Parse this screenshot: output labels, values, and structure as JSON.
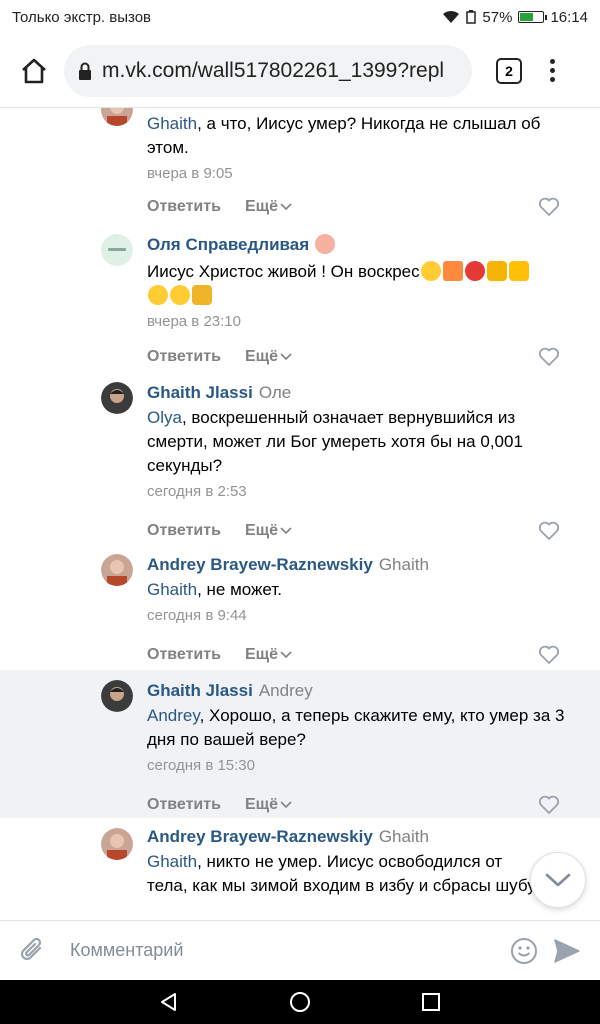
{
  "status_bar": {
    "carrier_text": "Только экстр. вызов",
    "battery_percent": "57%",
    "battery_level": 0.57,
    "time": "16:14"
  },
  "browser": {
    "url": "m.vk.com/wall517802261_1399?repl",
    "tab_count": "2"
  },
  "comments": [
    {
      "author": "",
      "reply_to": "",
      "mention": "Ghaith",
      "text": ", а что, Иисус умер? Никогда не слышал об этом.",
      "time": "вчера в 9:05",
      "reply_label": "Ответить",
      "more_label": "Ещё"
    },
    {
      "author": "Оля Справедливая",
      "reply_to": "",
      "mention": "",
      "text": "Иисус Христос живой ! Он воскрес",
      "time": "вчера в 23:10",
      "reply_label": "Ответить",
      "more_label": "Ещё"
    },
    {
      "author": "Ghaith Jlassi",
      "reply_to": "Оле",
      "mention": "Olya",
      "text": ", воскрешенный означает вернувшийся из смерти, может ли Бог умереть хотя бы на 0,001 секунды?",
      "time": "сегодня в 2:53",
      "reply_label": "Ответить",
      "more_label": "Ещё"
    },
    {
      "author": "Andrey Brayew-Raznewskiy",
      "reply_to": "Ghaith",
      "mention": "Ghaith",
      "text": ", не может.",
      "time": "сегодня в 9:44",
      "reply_label": "Ответить",
      "more_label": "Ещё"
    },
    {
      "author": "Ghaith Jlassi",
      "reply_to": "Andrey",
      "mention": "Andrey",
      "text": ", Хорошо, а теперь скажите ему, кто умер за 3 дня по вашей вере?",
      "time": "сегодня в 15:30",
      "reply_label": "Ответить",
      "more_label": "Ещё"
    },
    {
      "author": "Andrey Brayew-Raznewskiy",
      "reply_to": "Ghaith",
      "mention": "Ghaith",
      "text": ", никто не умер. Иисус освободился от тела, как мы зимой входим в избу и сбрасы шубу.",
      "time": "",
      "reply_label": "",
      "more_label": ""
    }
  ],
  "composer": {
    "placeholder": "Комментарий"
  },
  "colors": {
    "link": "#2a5885",
    "meta": "#939393",
    "highlight": "#f0f2f5"
  }
}
